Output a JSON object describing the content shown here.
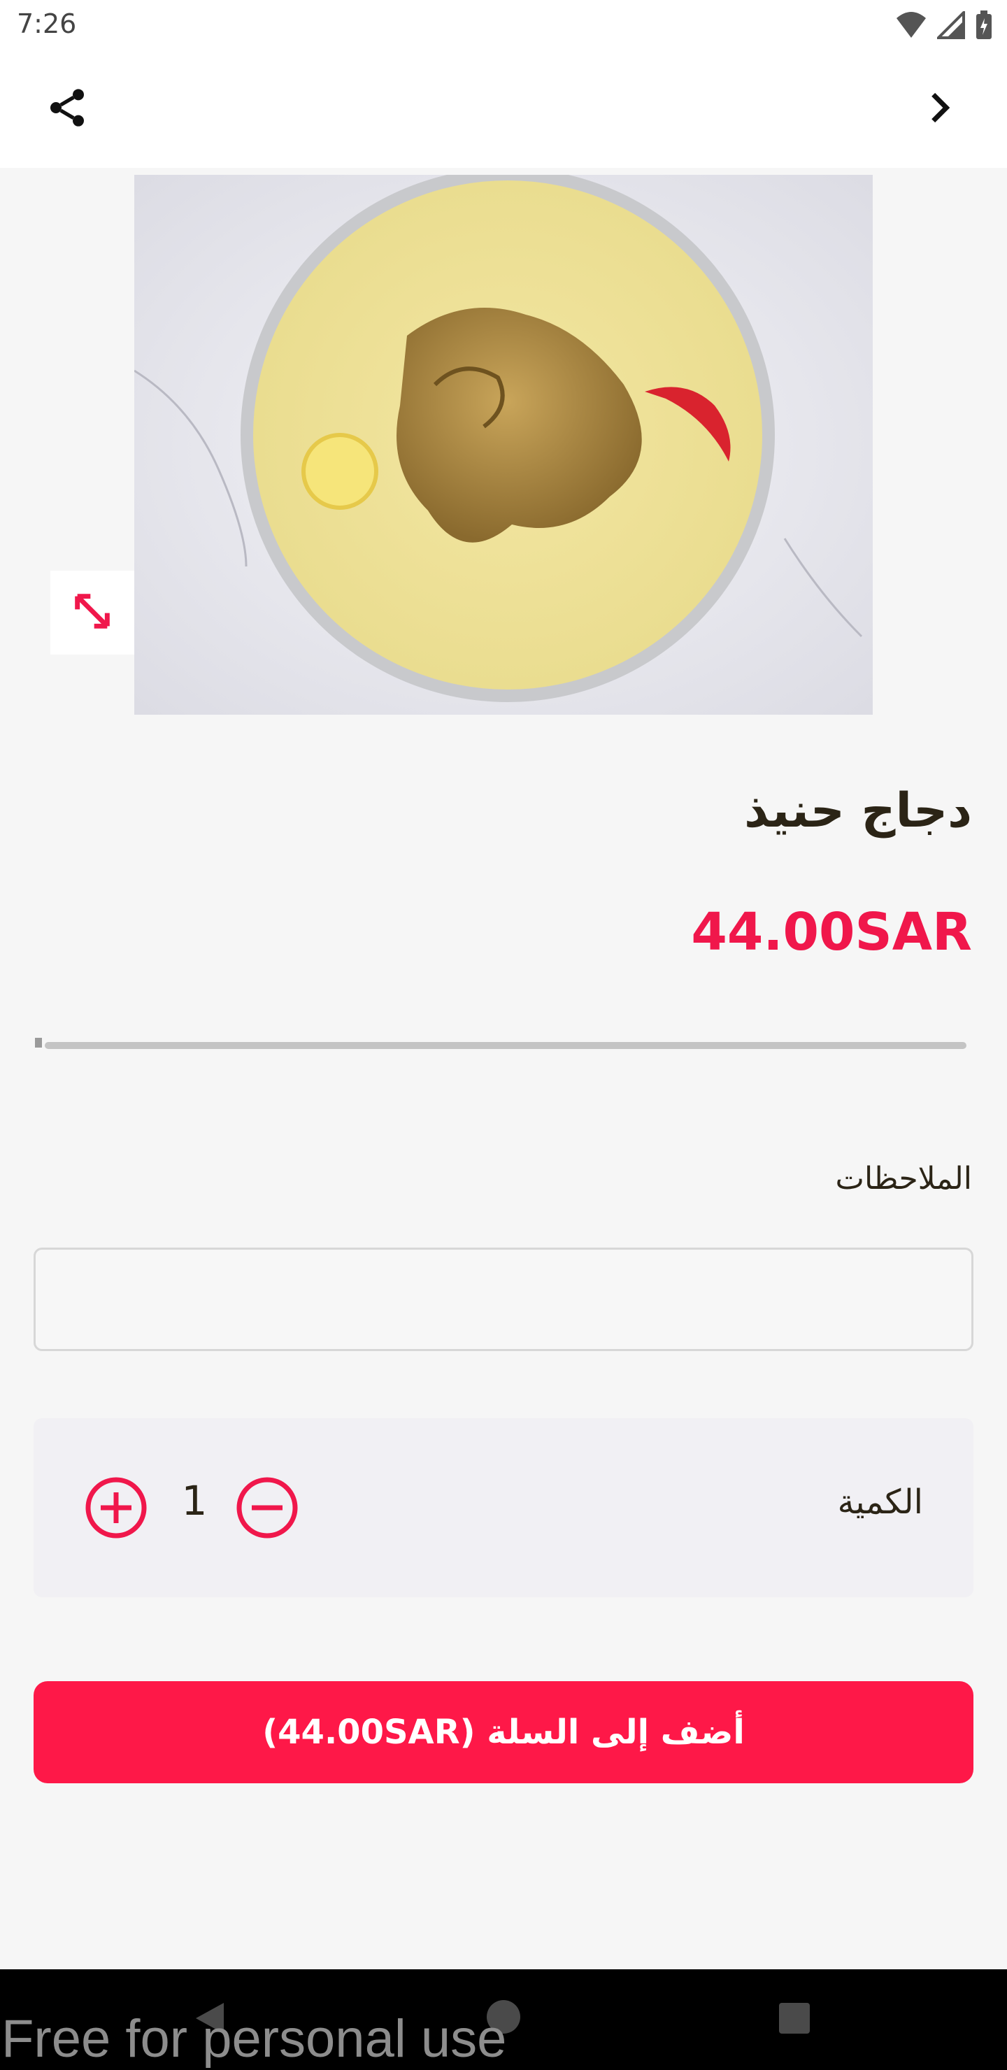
{
  "status_bar": {
    "time": "7:26"
  },
  "product": {
    "name": "دجاج حنيذ",
    "price": "44.00SAR",
    "image_icon": "product-photo"
  },
  "notes": {
    "label": "الملاحظات",
    "value": "",
    "placeholder": ""
  },
  "quantity": {
    "label": "الكمية",
    "value": "1"
  },
  "cart_button": {
    "label": "أضف إلى السلة (44.00SAR)"
  },
  "watermark": "Free for personal use",
  "colors": {
    "accent": "#fe1848",
    "price": "#f0174b",
    "text": "#2b2416",
    "background": "#f6f6f6"
  },
  "icons": [
    "share-icon",
    "chevron-right-icon",
    "expand-icon",
    "plus-circle-icon",
    "minus-circle-icon",
    "wifi-icon",
    "signal-icon",
    "battery-icon",
    "back-icon",
    "home-icon",
    "recent-apps-icon"
  ]
}
